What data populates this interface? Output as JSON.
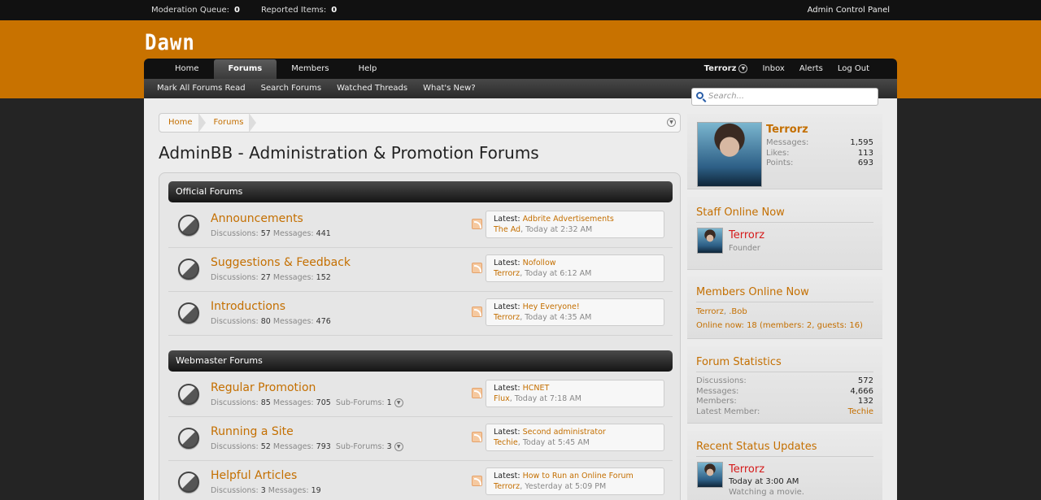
{
  "adminbar": {
    "moderation_label": "Moderation Queue:",
    "moderation_count": "0",
    "reported_label": "Reported Items:",
    "reported_count": "0",
    "acp_label": "Admin Control Panel"
  },
  "logo": "Dawn",
  "nav": {
    "tabs": [
      "Home",
      "Forums",
      "Members",
      "Help"
    ],
    "active_tab": "Forums",
    "username": "Terrorz",
    "right_links": [
      "Inbox",
      "Alerts",
      "Log Out"
    ],
    "subnav": [
      "Mark All Forums Read",
      "Search Forums",
      "Watched Threads",
      "What's New?"
    ]
  },
  "search": {
    "placeholder": "Search..."
  },
  "breadcrumb": [
    "Home",
    "Forums"
  ],
  "page_title": "AdminBB - Administration & Promotion Forums",
  "categories": [
    {
      "title": "Official Forums",
      "forums": [
        {
          "title": "Announcements",
          "discussions": "57",
          "messages": "441",
          "subforums": "",
          "latest_title": "Adbrite Advertisements",
          "latest_user": "The Ad",
          "latest_date": "Today at 2:32 AM"
        },
        {
          "title": "Suggestions & Feedback",
          "discussions": "27",
          "messages": "152",
          "subforums": "",
          "latest_title": "Nofollow",
          "latest_user": "Terrorz",
          "latest_date": "Today at 6:12 AM"
        },
        {
          "title": "Introductions",
          "discussions": "80",
          "messages": "476",
          "subforums": "",
          "latest_title": "Hey Everyone!",
          "latest_user": "Terrorz",
          "latest_date": "Today at 4:35 AM"
        }
      ]
    },
    {
      "title": "Webmaster Forums",
      "forums": [
        {
          "title": "Regular Promotion",
          "discussions": "85",
          "messages": "705",
          "subforums": "1",
          "latest_title": "HCNET",
          "latest_user": "Flux",
          "latest_date": "Today at 7:18 AM"
        },
        {
          "title": "Running a Site",
          "discussions": "52",
          "messages": "793",
          "subforums": "3",
          "latest_title": "Second administrator",
          "latest_user": "Techie",
          "latest_date": "Today at 5:45 AM"
        },
        {
          "title": "Helpful Articles",
          "discussions": "3",
          "messages": "19",
          "subforums": "",
          "latest_title": "How to Run an Online Forum",
          "latest_user": "Terrorz",
          "latest_date": "Yesterday at 5:09 PM"
        }
      ]
    }
  ],
  "labels": {
    "discussions": "Discussions:",
    "messages": "Messages:",
    "subforums": "Sub-Forums:",
    "latest": "Latest:"
  },
  "visitor": {
    "name": "Terrorz",
    "stats": [
      {
        "label": "Messages:",
        "value": "1,595"
      },
      {
        "label": "Likes:",
        "value": "113"
      },
      {
        "label": "Points:",
        "value": "693"
      }
    ]
  },
  "staff_online": {
    "title": "Staff Online Now",
    "name": "Terrorz",
    "role": "Founder"
  },
  "members_online": {
    "title": "Members Online Now",
    "member1": "Terrorz",
    "member2": ".Bob",
    "summary": "Online now: 18 (members: 2, guests: 16)"
  },
  "forum_stats": {
    "title": "Forum Statistics",
    "rows": [
      {
        "label": "Discussions:",
        "value": "572"
      },
      {
        "label": "Messages:",
        "value": "4,666"
      },
      {
        "label": "Members:",
        "value": "132"
      },
      {
        "label": "Latest Member:",
        "value": "Techie"
      }
    ]
  },
  "status_updates": {
    "title": "Recent Status Updates",
    "name": "Terrorz",
    "date": "Today at 3:00 AM",
    "text": "Watching a movie."
  }
}
